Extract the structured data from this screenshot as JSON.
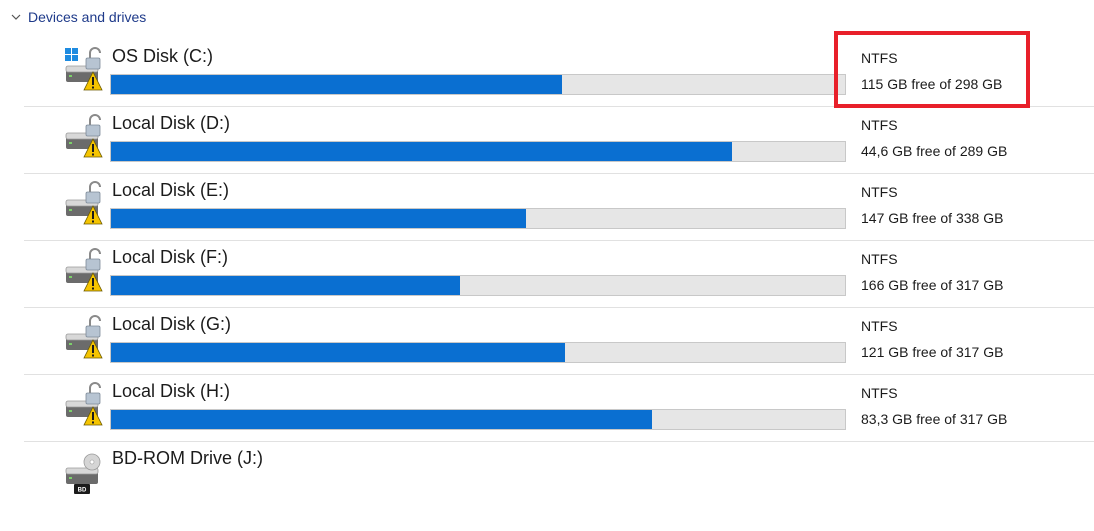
{
  "section": {
    "title": "Devices and drives",
    "chevron_icon": "chevron-down-icon"
  },
  "drives": [
    {
      "name": "OS Disk (C:)",
      "filesystem": "NTFS",
      "space_text": "115 GB free of 298 GB",
      "used_fraction": 0.614,
      "icon": "windows-locked-warning-drive-icon",
      "has_bar": true
    },
    {
      "name": "Local Disk (D:)",
      "filesystem": "NTFS",
      "space_text": "44,6 GB free of 289 GB",
      "used_fraction": 0.846,
      "icon": "locked-warning-drive-icon",
      "has_bar": true
    },
    {
      "name": "Local Disk (E:)",
      "filesystem": "NTFS",
      "space_text": "147 GB free of 338 GB",
      "used_fraction": 0.565,
      "icon": "locked-warning-drive-icon",
      "has_bar": true
    },
    {
      "name": "Local Disk (F:)",
      "filesystem": "NTFS",
      "space_text": "166 GB free of 317 GB",
      "used_fraction": 0.476,
      "icon": "locked-warning-drive-icon",
      "has_bar": true
    },
    {
      "name": "Local Disk (G:)",
      "filesystem": "NTFS",
      "space_text": "121 GB free of 317 GB",
      "used_fraction": 0.618,
      "icon": "locked-warning-drive-icon",
      "has_bar": true
    },
    {
      "name": "Local Disk (H:)",
      "filesystem": "NTFS",
      "space_text": "83,3 GB free of 317 GB",
      "used_fraction": 0.737,
      "icon": "locked-warning-drive-icon",
      "has_bar": true
    },
    {
      "name": "BD-ROM Drive (J:)",
      "filesystem": "",
      "space_text": "",
      "used_fraction": null,
      "icon": "bd-rom-drive-icon",
      "has_bar": false,
      "bd_label": "BD"
    }
  ],
  "colors": {
    "bar_fill": "#0a6fd1",
    "bar_track": "#e6e6e6",
    "section_header": "#1e3a8a",
    "highlight": "#e8202a",
    "warning": "#f5c400"
  }
}
